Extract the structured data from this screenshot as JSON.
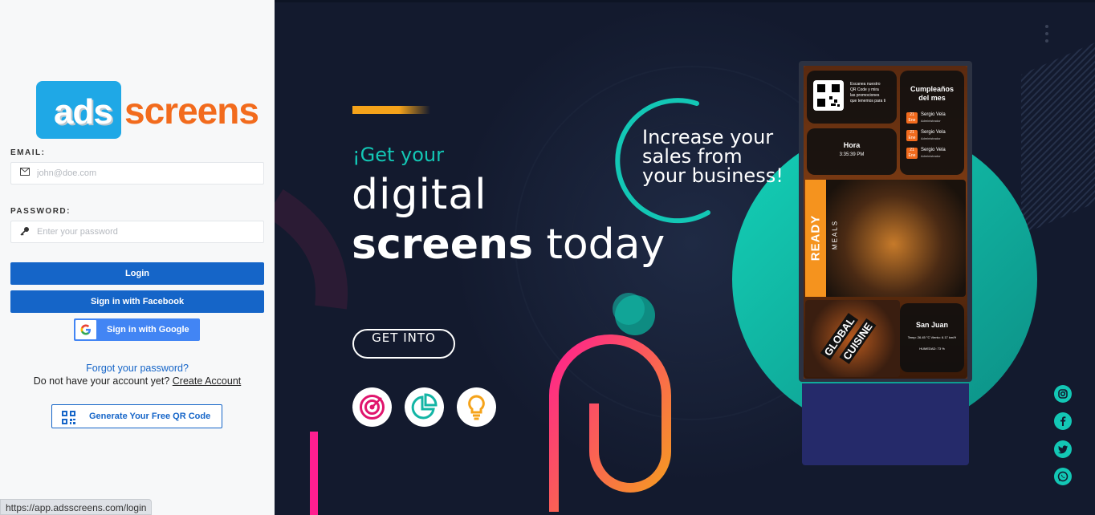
{
  "login": {
    "logo": {
      "part1": "ads",
      "part2": "screens"
    },
    "email_label": "EMAIL:",
    "email_placeholder": "john@doe.com",
    "password_label": "PASSWORD:",
    "password_placeholder": "Enter your password",
    "login_button": "Login",
    "facebook_button": "Sign in with Facebook",
    "google_button": "Sign in with Google",
    "forgot_password": "Forgot your password?",
    "no_account_text": "Do not have your account yet?",
    "create_account": "Create Account",
    "qr_button": "Generate Your Free QR Code"
  },
  "status_bar": {
    "url": "https://app.adsscreens.com/login"
  },
  "hero": {
    "line1": "¡Get your",
    "line2": "digital",
    "line3_bold": "screens",
    "line3_rest": " today",
    "cta": "GET INTO",
    "tagline": [
      "Increase your",
      "sales from",
      "your business!"
    ],
    "feature_icons": [
      "target-icon",
      "pie-chart-icon",
      "lightbulb-icon"
    ]
  },
  "kiosk": {
    "qr_text": [
      "Escanea nuestro",
      "QR Code y mira",
      "las promociones",
      "que tenemos para ti"
    ],
    "birthdays_title": [
      "Cumpleaños",
      "del mes"
    ],
    "birthdays": [
      {
        "day": "21",
        "month": "Ene",
        "name": "Sergio Vela",
        "role": "Administrador"
      },
      {
        "day": "21",
        "month": "Ene",
        "name": "Sergio Vela",
        "role": "Administrador"
      },
      {
        "day": "21",
        "month": "Ene",
        "name": "Sergio Vela",
        "role": "Administrador"
      }
    ],
    "time_label": "Hora",
    "time_value": "3:35:39 PM",
    "ready": "READY",
    "meals": "MEALS",
    "global": "GLOBAL",
    "cuisine": "CUISINE",
    "weather_city": "San Juan",
    "weather_line": "Temp: 26.45 °C Viento: 6.17 km/H",
    "humidity": "HUMEDAD: 73 %"
  },
  "social": [
    "instagram-icon",
    "facebook-icon",
    "twitter-icon",
    "whatsapp-icon"
  ],
  "colors": {
    "primary": "#1565c8",
    "teal": "#13c7b5",
    "orange": "#f26b1d",
    "dark_bg": "#131a2e"
  }
}
